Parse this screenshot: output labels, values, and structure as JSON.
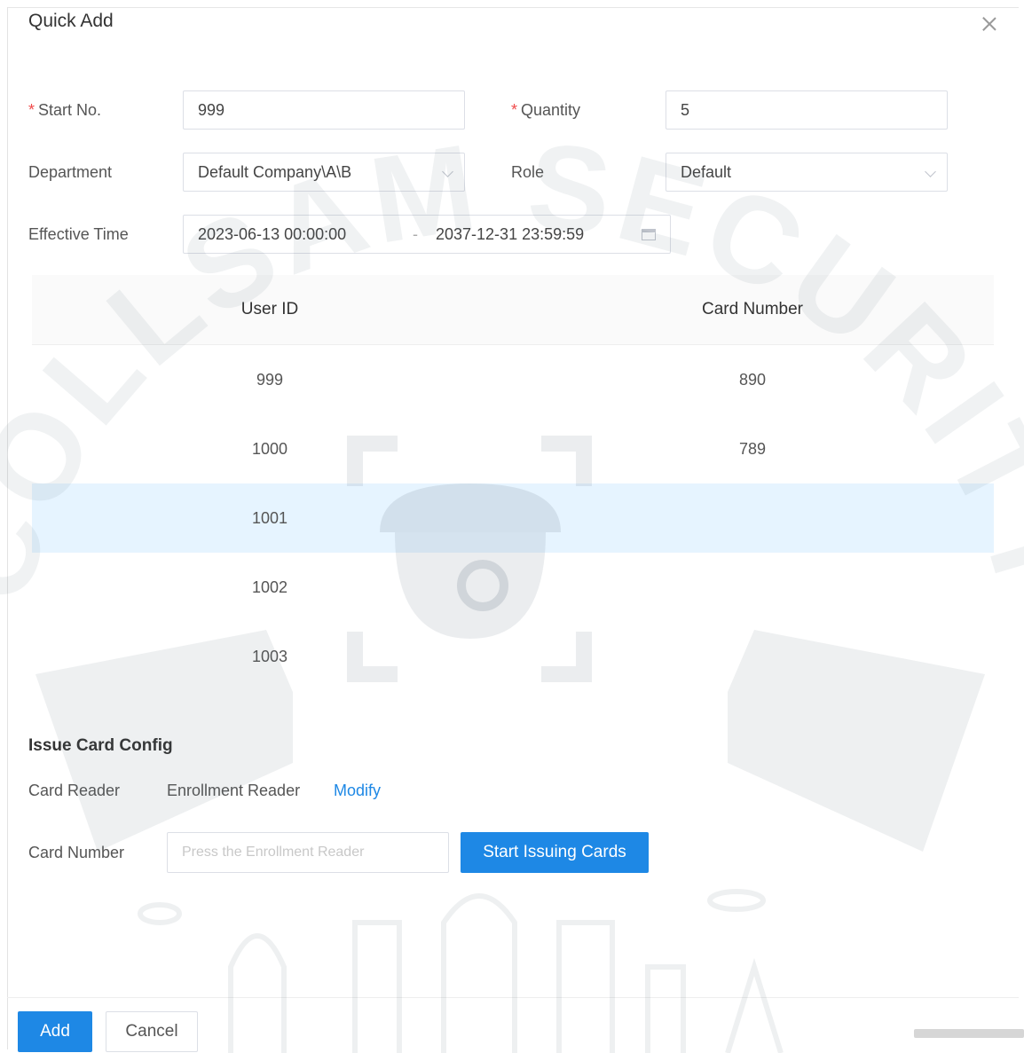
{
  "dialog": {
    "title": "Quick Add"
  },
  "form": {
    "start_no": {
      "label": "Start No.",
      "value": "999"
    },
    "quantity": {
      "label": "Quantity",
      "value": "5"
    },
    "department": {
      "label": "Department",
      "value": "Default Company\\A\\B"
    },
    "role": {
      "label": "Role",
      "value": "Default"
    },
    "effective_time": {
      "label": "Effective Time",
      "start": "2023-06-13 00:00:00",
      "separator": "-",
      "end": "2037-12-31 23:59:59"
    }
  },
  "table": {
    "headers": {
      "user_id": "User ID",
      "card_number": "Card Number"
    },
    "rows": [
      {
        "user_id": "999",
        "card_number": "890"
      },
      {
        "user_id": "1000",
        "card_number": "789"
      },
      {
        "user_id": "1001",
        "card_number": "",
        "selected": true
      },
      {
        "user_id": "1002",
        "card_number": ""
      },
      {
        "user_id": "1003",
        "card_number": ""
      }
    ]
  },
  "issue_card": {
    "title": "Issue Card Config",
    "card_reader_label": "Card Reader",
    "card_reader_value": "Enrollment Reader",
    "modify_link": "Modify",
    "card_number_label": "Card Number",
    "card_number_placeholder": "Press the Enrollment Reader",
    "start_button": "Start Issuing Cards"
  },
  "footer": {
    "add_button": "Add",
    "cancel_button": "Cancel"
  },
  "watermark": {
    "text": "COLLSAM SECURITY"
  },
  "colors": {
    "primary": "#1e88e5",
    "required": "#f04a4a",
    "selected_row": "#e6f4ff"
  }
}
